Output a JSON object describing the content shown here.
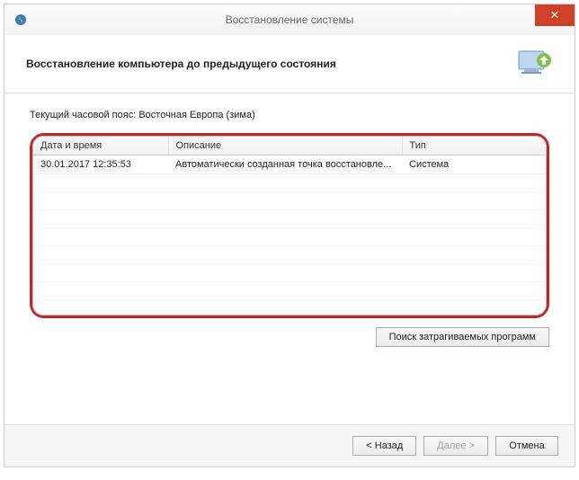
{
  "window": {
    "title": "Восстановление системы",
    "close_label": "✕"
  },
  "header": {
    "text": "Восстановление компьютера до предыдущего состояния"
  },
  "content": {
    "timezone_text": "Текущий часовой пояс: Восточная Европа (зима)"
  },
  "table": {
    "columns": {
      "date": "Дата и время",
      "desc": "Описание",
      "type": "Тип"
    },
    "rows": [
      {
        "date": "30.01.2017 12:35:53",
        "desc": "Автоматически созданная точка восстановле...",
        "type": "Система"
      }
    ]
  },
  "buttons": {
    "scan": "Поиск затрагиваемых программ",
    "back": "< Назад",
    "next": "Далее >",
    "cancel": "Отмена"
  }
}
